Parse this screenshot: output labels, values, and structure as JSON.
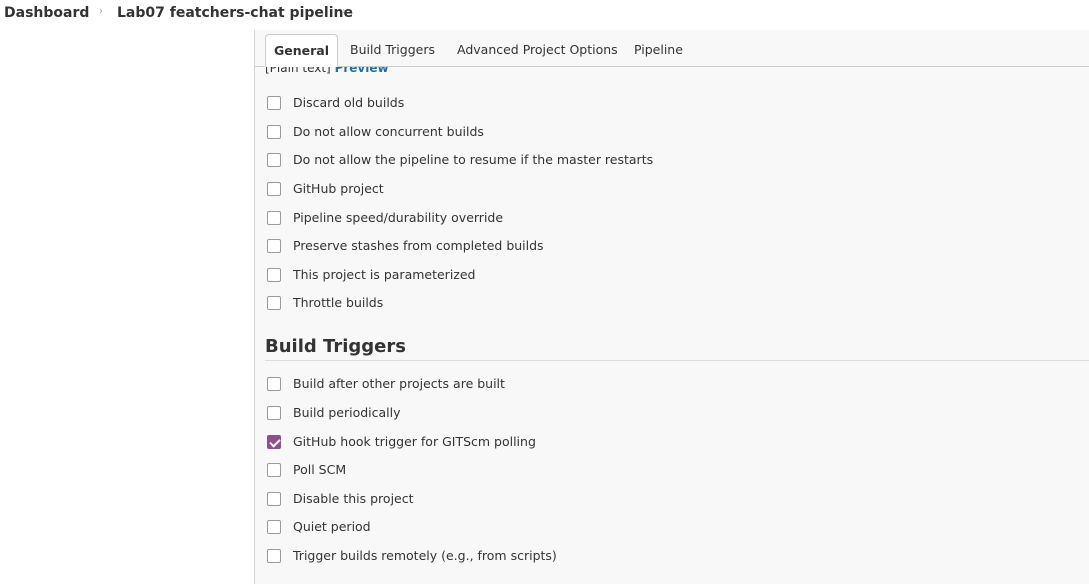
{
  "breadcrumb": {
    "items": [
      "Dashboard",
      "Lab07 featchers-chat pipeline"
    ],
    "separator": "›"
  },
  "tabs": [
    {
      "label": "General",
      "active": true
    },
    {
      "label": "Build Triggers",
      "active": false
    },
    {
      "label": "Advanced Project Options",
      "active": false
    },
    {
      "label": "Pipeline",
      "active": false
    }
  ],
  "description": {
    "format_text": "[Plain text]",
    "preview_link": "Preview"
  },
  "general": {
    "options": [
      {
        "label": "Discard old builds",
        "checked": false
      },
      {
        "label": "Do not allow concurrent builds",
        "checked": false
      },
      {
        "label": "Do not allow the pipeline to resume if the master restarts",
        "checked": false
      },
      {
        "label": "GitHub project",
        "checked": false
      },
      {
        "label": "Pipeline speed/durability override",
        "checked": false
      },
      {
        "label": "Preserve stashes from completed builds",
        "checked": false
      },
      {
        "label": "This project is parameterized",
        "checked": false
      },
      {
        "label": "Throttle builds",
        "checked": false
      }
    ]
  },
  "build_triggers": {
    "title": "Build Triggers",
    "options": [
      {
        "label": "Build after other projects are built",
        "checked": false
      },
      {
        "label": "Build periodically",
        "checked": false
      },
      {
        "label": "GitHub hook trigger for GITScm polling",
        "checked": true
      },
      {
        "label": "Poll SCM",
        "checked": false
      },
      {
        "label": "Disable this project",
        "checked": false
      },
      {
        "label": "Quiet period",
        "checked": false
      },
      {
        "label": "Trigger builds remotely (e.g., from scripts)",
        "checked": false
      }
    ]
  },
  "colors": {
    "checkbox_checked": "#8e4f8f",
    "link": "#1d6fa5"
  }
}
